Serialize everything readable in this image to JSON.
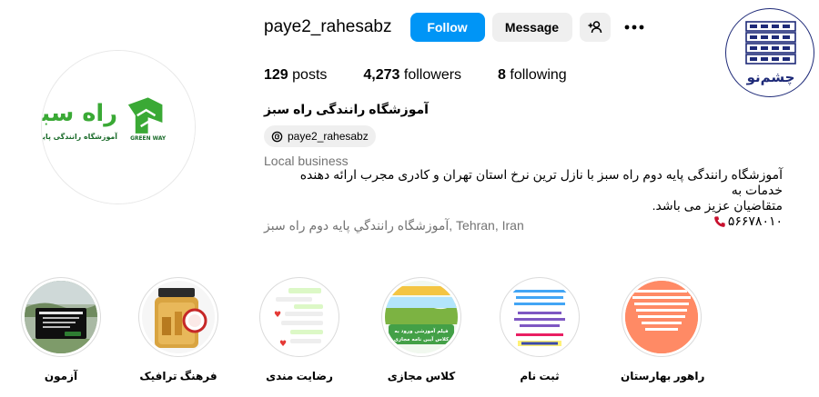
{
  "profile": {
    "username": "paye2_rahesabz",
    "follow_label": "Follow",
    "message_label": "Message",
    "stats": {
      "posts_count": "129",
      "posts_label": "posts",
      "followers_count": "4,273",
      "followers_label": "followers",
      "following_count": "8",
      "following_label": "following"
    },
    "full_name": "آموزشگاه رانندگی راه سبز",
    "threads_handle": "paye2_rahesabz",
    "category": "Local business",
    "bio_line1": "آموزشگاه رانندگی پایه دوم راه سبز با نازل ترین نرخ استان تهران و کادری مجرب ارائه دهنده خدمات به",
    "bio_line2": "متقاضیان عزیز می باشد.",
    "phone": "۵۶۶۷۸۰۱۰",
    "address": "آموزشگاه رانندگي پايه دوم راه سبز, Tehran, Iran"
  },
  "avatar_logo": {
    "title": "راه سبز",
    "subtitle": "آموزشگاه رانندگی پایه دوم",
    "brand": "GREEN WAY"
  },
  "watermark_logo": {
    "text": "چشم‌نو"
  },
  "highlights": [
    {
      "label": "راهور بهارستان",
      "cover_text": "در راهور بهارستان ، راهور یه راه تاران، شهرداد امام حسین(ع)، خیابان ۱۲ شوهری عاشورا، کوچه گل نرگس ۷، طبقه فوقانی آتشنشانی"
    },
    {
      "label": "ثبت نام",
      "cover_text": "ثبت نام پایه دوم"
    },
    {
      "label": "کلاس مجازی",
      "cover_text": "فیلم آموزشی ورود به کلاس آیین نامه مجازی"
    },
    {
      "label": "رضایت مندی",
      "cover_text": ""
    },
    {
      "label": "فرهنگ ترافیک",
      "cover_text": ""
    },
    {
      "label": "آزمون",
      "cover_text": ""
    }
  ],
  "colors": {
    "follow_blue": "#0095f6",
    "button_gray": "#efefef",
    "logo_green": "#3aa935",
    "logo_navy": "#1e2a78"
  }
}
